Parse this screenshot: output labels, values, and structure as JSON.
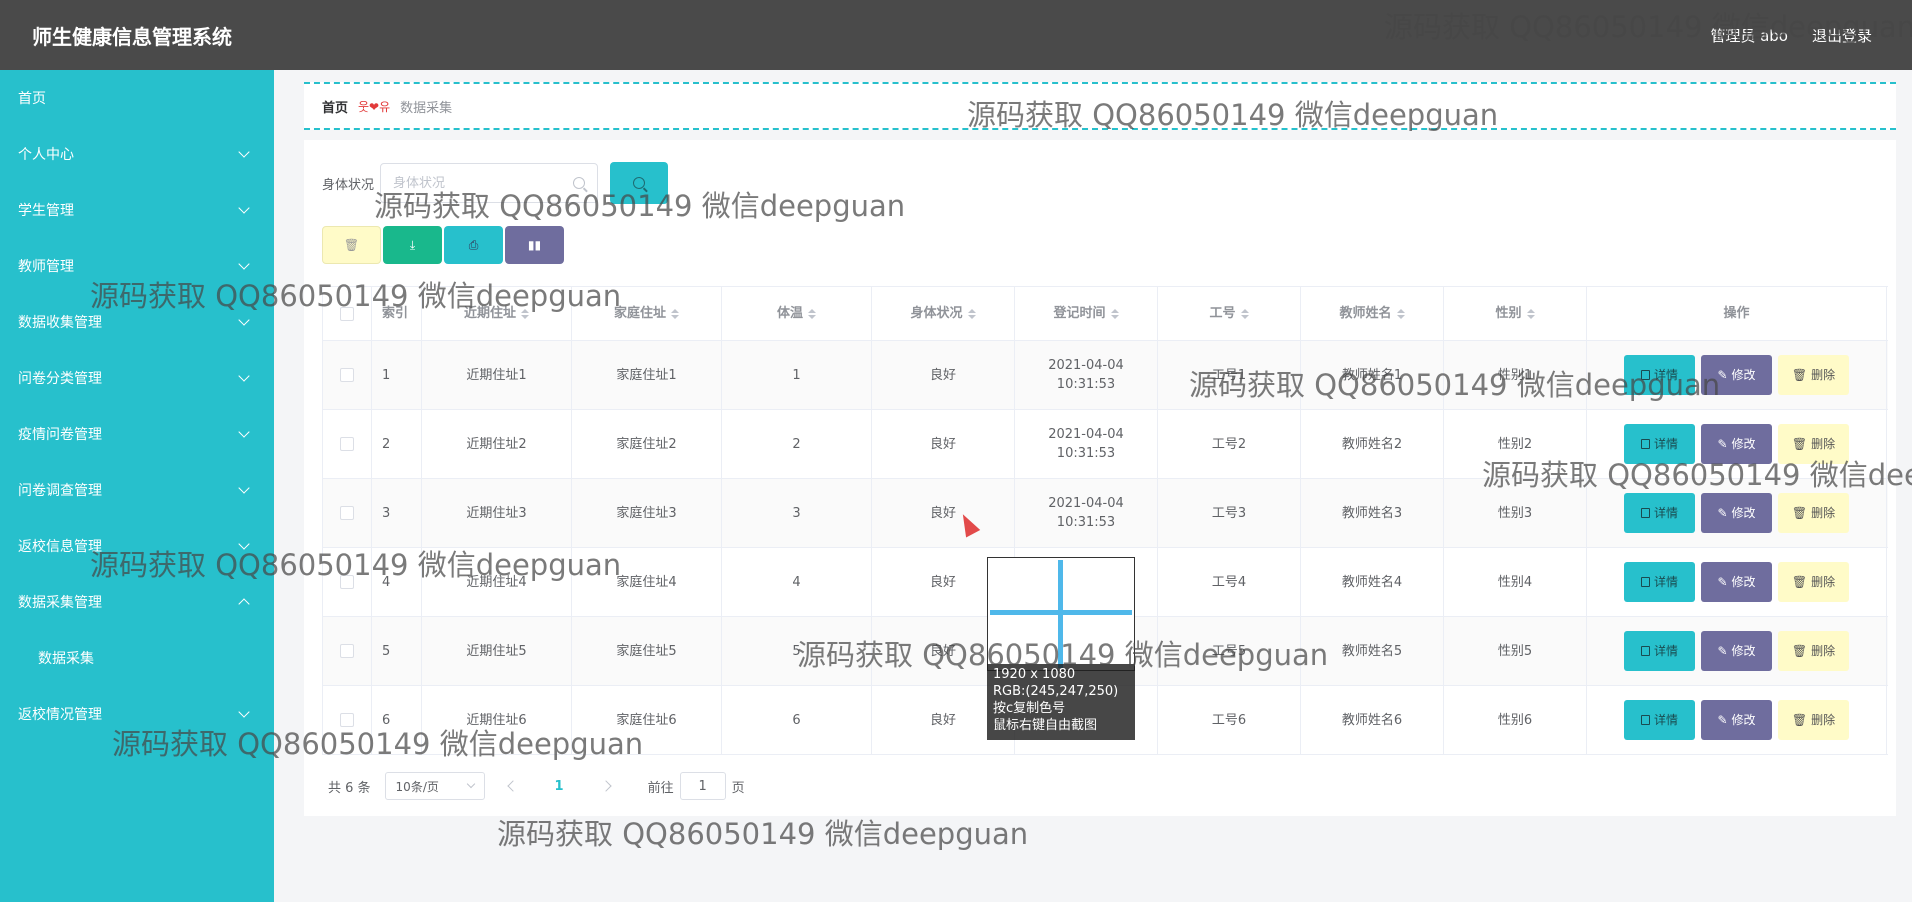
{
  "app": {
    "title": "师生健康信息管理系统"
  },
  "header": {
    "user": "管理员 abo",
    "logout": "退出登录"
  },
  "sidebar": {
    "items": [
      {
        "label": "首页",
        "chevron": ""
      },
      {
        "label": "个人中心",
        "chevron": "down"
      },
      {
        "label": "学生管理",
        "chevron": "down"
      },
      {
        "label": "教师管理",
        "chevron": "down"
      },
      {
        "label": "数据收集管理",
        "chevron": "down"
      },
      {
        "label": "问卷分类管理",
        "chevron": "down"
      },
      {
        "label": "疫情问卷管理",
        "chevron": "down"
      },
      {
        "label": "问卷调查管理",
        "chevron": "down"
      },
      {
        "label": "返校信息管理",
        "chevron": "down"
      },
      {
        "label": "数据采集管理",
        "chevron": "up"
      },
      {
        "label": "数据采集",
        "chevron": ""
      },
      {
        "label": "返校情况管理",
        "chevron": "down"
      }
    ]
  },
  "breadcrumb": {
    "home": "首页",
    "separator": "웃❤유",
    "current": "数据采集"
  },
  "search": {
    "label": "身体状况",
    "placeholder": "身体状况"
  },
  "table": {
    "columns": [
      "索引",
      "近期住址",
      "家庭住址",
      "体温",
      "身体状况",
      "登记时间",
      "工号",
      "教师姓名",
      "性别",
      "操作"
    ],
    "rows": [
      {
        "index": "1",
        "recent": "近期住址1",
        "home": "家庭住址1",
        "temp": "1",
        "status": "良好",
        "time": "2021-04-04 10:31:53",
        "no": "工号1",
        "name": "教师姓名1",
        "gender": "性别1"
      },
      {
        "index": "2",
        "recent": "近期住址2",
        "home": "家庭住址2",
        "temp": "2",
        "status": "良好",
        "time": "2021-04-04 10:31:53",
        "no": "工号2",
        "name": "教师姓名2",
        "gender": "性别2"
      },
      {
        "index": "3",
        "recent": "近期住址3",
        "home": "家庭住址3",
        "temp": "3",
        "status": "良好",
        "time": "2021-04-04 10:31:53",
        "no": "工号3",
        "name": "教师姓名3",
        "gender": "性别3"
      },
      {
        "index": "4",
        "recent": "近期住址4",
        "home": "家庭住址4",
        "temp": "4",
        "status": "良好",
        "time": "",
        "no": "工号4",
        "name": "教师姓名4",
        "gender": "性别4"
      },
      {
        "index": "5",
        "recent": "近期住址5",
        "home": "家庭住址5",
        "temp": "5",
        "status": "良好",
        "time": "",
        "no": "工号5",
        "name": "教师姓名5",
        "gender": "性别5"
      },
      {
        "index": "6",
        "recent": "近期住址6",
        "home": "家庭住址6",
        "temp": "6",
        "status": "良好",
        "time": "",
        "no": "工号6",
        "name": "教师姓名6",
        "gender": "性别6"
      }
    ],
    "actions": {
      "detail": "详情",
      "edit": "修改",
      "delete": "删除"
    }
  },
  "pagination": {
    "total": "共 6 条",
    "page_size": "10条/页",
    "current": "1",
    "goto": "前往",
    "goto_value": "1",
    "page_unit": "页"
  },
  "capture": {
    "size": "1920 x 1080",
    "rgb": "RGB:(245,247,250)",
    "hint1": "按c复制色号",
    "hint2": "鼠标右键自由截图"
  },
  "watermark": "源码获取 QQ86050149 微信deepguan",
  "colors": {
    "sidebar": "#27c0cc",
    "header": "#4a4a4a",
    "detail": "#27c0cc",
    "edit": "#6f6d9e",
    "delete": "#fffbc8",
    "download": "#19b88c"
  }
}
